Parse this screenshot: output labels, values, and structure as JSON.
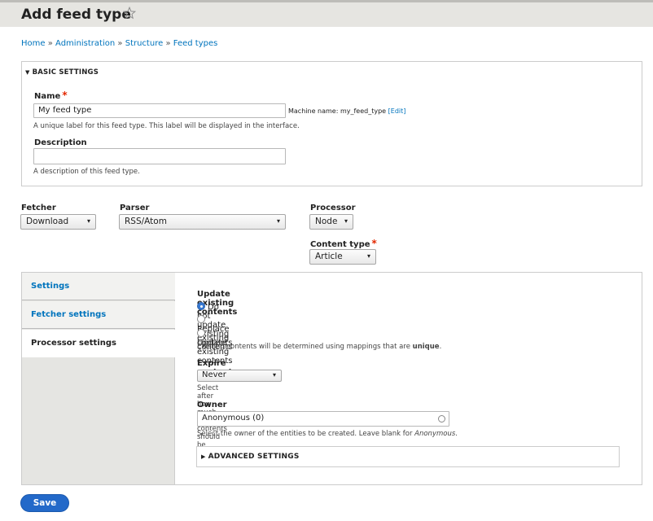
{
  "header": {
    "title": "Add feed type",
    "star_icon": "star-outline-icon"
  },
  "breadcrumb": [
    "Home",
    "Administration",
    "Structure",
    "Feed types"
  ],
  "breadcrumb_separator": "»",
  "basic_settings": {
    "legend": "BASIC SETTINGS",
    "name_label": "Name",
    "required_mark": "*",
    "name_value": "My feed type",
    "machine_name_prefix": "Machine name: my_feed_type",
    "machine_name_edit": "[Edit]",
    "name_desc": "A unique label for this feed type. This label will be displayed in the interface.",
    "description_label": "Description",
    "description_value": "",
    "description_desc": "A description of this feed type."
  },
  "plugins": {
    "fetcher_label": "Fetcher",
    "fetcher_value": "Download",
    "parser_label": "Parser",
    "parser_value": "RSS/Atom",
    "processor_label": "Processor",
    "processor_value": "Node",
    "content_type_label": "Content type",
    "content_type_value": "Article",
    "caret": "▾"
  },
  "tabs": [
    {
      "label": "Settings",
      "active": false
    },
    {
      "label": "Fetcher settings",
      "active": false
    },
    {
      "label": "Processor settings",
      "active": true
    }
  ],
  "processor_pane": {
    "update_label": "Update existing contents",
    "update_options": [
      {
        "label": "Do not update existing contents",
        "selected": true
      },
      {
        "label": "Replace existing contents",
        "selected": false
      },
      {
        "label": "Update existing contents",
        "selected": false
      }
    ],
    "update_desc_prefix": "Existing contents will be determined using mappings that are",
    "update_desc_bold": "unique",
    "update_desc_suffix": ".",
    "expire_label": "Expire contents",
    "expire_value": "Never",
    "expire_desc": "Select after how much time contents should be deleted.",
    "owner_label": "Owner",
    "owner_value": "Anonymous (0)",
    "owner_desc_prefix": "Select the owner of the entities to be created. Leave blank for",
    "owner_desc_italic": "Anonymous",
    "owner_desc_suffix": ".",
    "advanced_legend": "ADVANCED SETTINGS"
  },
  "actions": {
    "save_label": "Save"
  },
  "colors": {
    "link": "#0074bd",
    "primary_button": "#2369c9",
    "required": "#e32700",
    "header_bg": "#e6e5e1"
  }
}
